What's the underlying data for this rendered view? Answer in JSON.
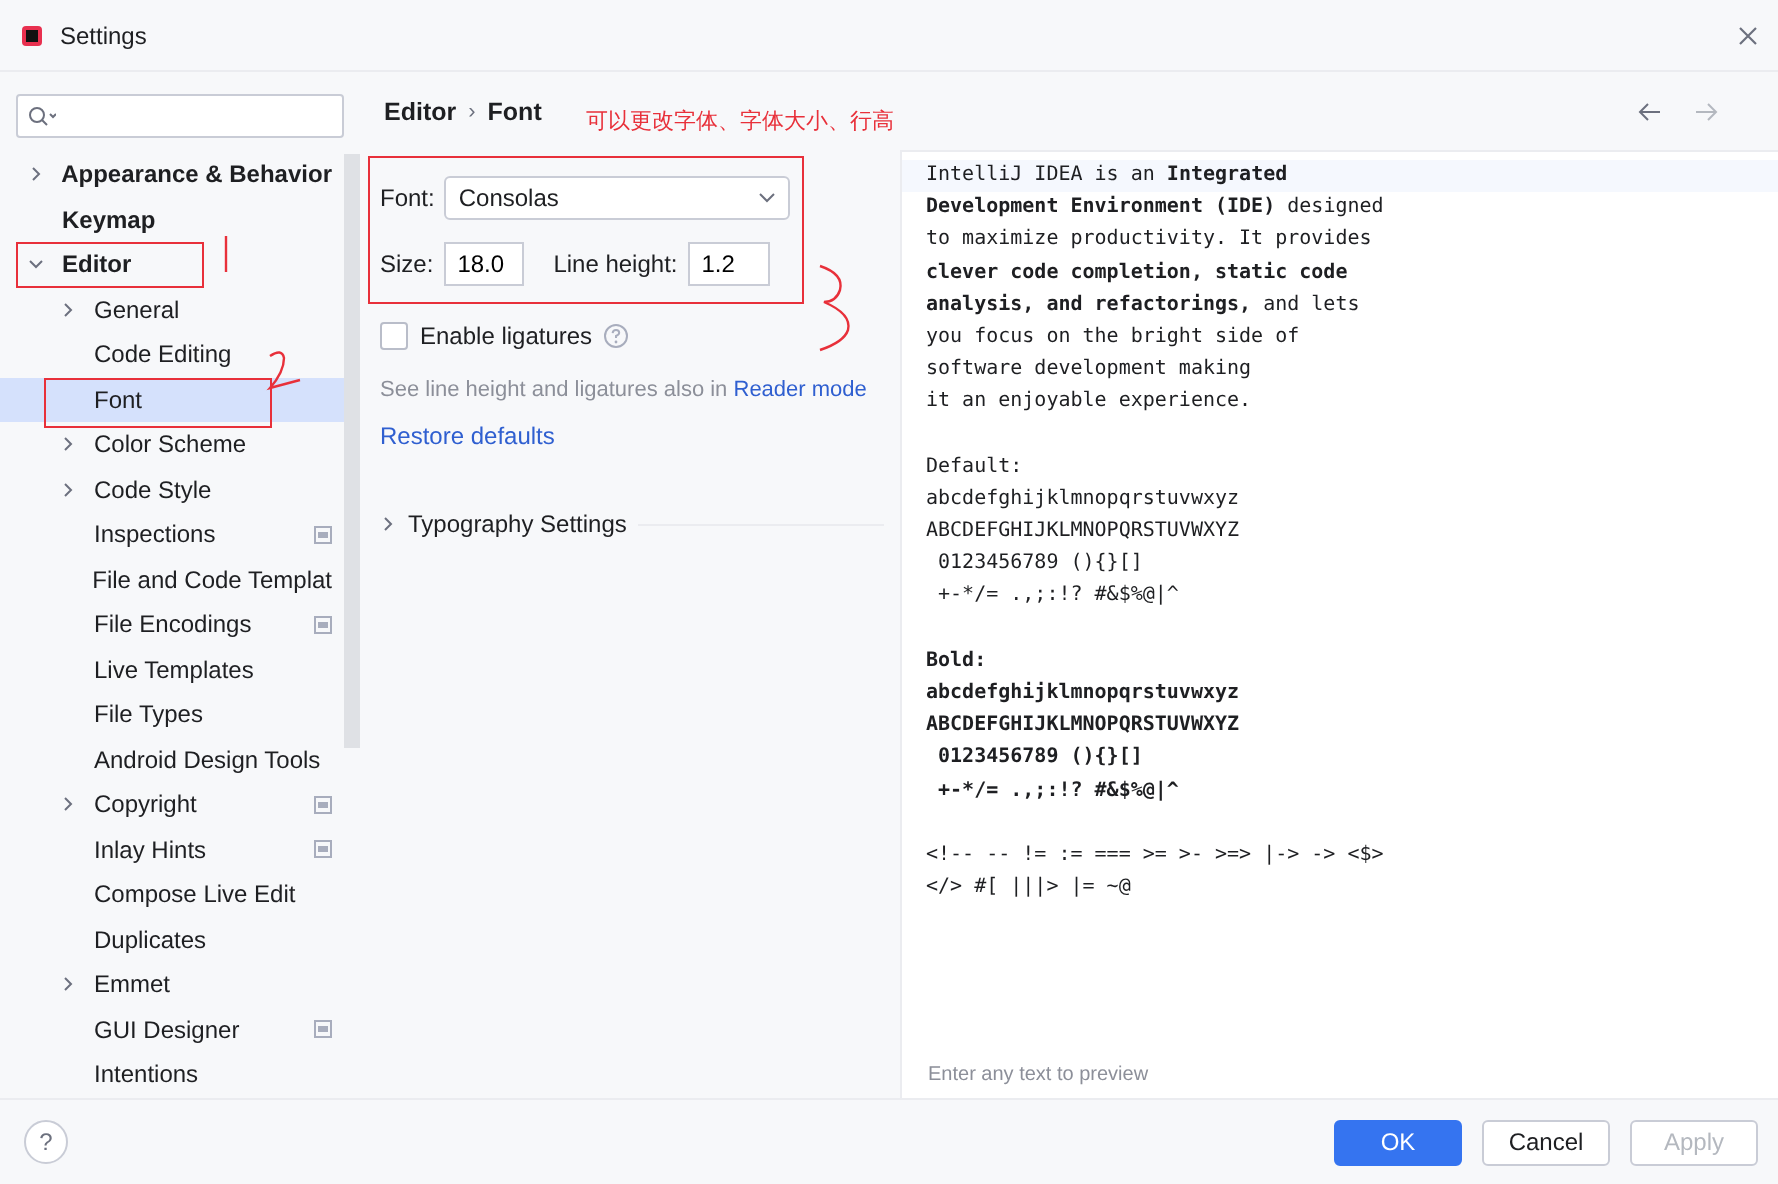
{
  "window": {
    "title": "Settings"
  },
  "sidebar": {
    "items": [
      {
        "label": "Appearance & Behavior",
        "expandable": true,
        "expanded": false,
        "selected": false,
        "scoped": false
      },
      {
        "label": "Keymap",
        "expandable": false,
        "selected": false,
        "scoped": false
      },
      {
        "label": "Editor",
        "expandable": true,
        "expanded": true,
        "selected": false,
        "scoped": false,
        "children": [
          {
            "label": "General",
            "expandable": true,
            "expanded": false,
            "selected": false,
            "scoped": false
          },
          {
            "label": "Code Editing",
            "expandable": false,
            "selected": false,
            "scoped": false
          },
          {
            "label": "Font",
            "expandable": false,
            "selected": true,
            "scoped": false
          },
          {
            "label": "Color Scheme",
            "expandable": true,
            "expanded": false,
            "selected": false,
            "scoped": false
          },
          {
            "label": "Code Style",
            "expandable": true,
            "expanded": false,
            "selected": false,
            "scoped": false
          },
          {
            "label": "Inspections",
            "expandable": false,
            "selected": false,
            "scoped": true
          },
          {
            "label": "File and Code Templat",
            "expandable": false,
            "selected": false,
            "scoped": false
          },
          {
            "label": "File Encodings",
            "expandable": false,
            "selected": false,
            "scoped": true
          },
          {
            "label": "Live Templates",
            "expandable": false,
            "selected": false,
            "scoped": false
          },
          {
            "label": "File Types",
            "expandable": false,
            "selected": false,
            "scoped": false
          },
          {
            "label": "Android Design Tools",
            "expandable": false,
            "selected": false,
            "scoped": false
          },
          {
            "label": "Copyright",
            "expandable": true,
            "expanded": false,
            "selected": false,
            "scoped": true
          },
          {
            "label": "Inlay Hints",
            "expandable": false,
            "selected": false,
            "scoped": true
          },
          {
            "label": "Compose Live Edit",
            "expandable": false,
            "selected": false,
            "scoped": false
          },
          {
            "label": "Duplicates",
            "expandable": false,
            "selected": false,
            "scoped": false
          },
          {
            "label": "Emmet",
            "expandable": true,
            "expanded": false,
            "selected": false,
            "scoped": false
          },
          {
            "label": "GUI Designer",
            "expandable": false,
            "selected": false,
            "scoped": true
          },
          {
            "label": "Intentions",
            "expandable": false,
            "selected": false,
            "scoped": false
          }
        ]
      }
    ]
  },
  "breadcrumb": [
    "Editor",
    "Font"
  ],
  "breadcrumb_separator": "›",
  "help": "?",
  "form": {
    "font_label": "Font:",
    "font_value": "Consolas",
    "size_label": "Size:",
    "size_value": "18.0",
    "line_height_label": "Line height:",
    "line_height_value": "1.2",
    "ligatures": {
      "label": "Enable ligatures",
      "checked": false
    },
    "note": "See line height and ligatures also in",
    "note_link": "Reader mode",
    "restore": "Restore defaults",
    "typography": {
      "label": "Typography Settings",
      "expanded": false
    }
  },
  "preview": {
    "sections": [
      {
        "bold": false,
        "lines": [
          "IntelliJ IDEA is an **Integrated**",
          "**Development Environment (IDE)** designed",
          "to maximize productivity. It provides",
          "**clever code completion, static code**",
          "**analysis, and refactorings,** and lets",
          "you focus on the bright side of",
          "software development making",
          "it an enjoyable experience."
        ]
      },
      {
        "bold": false,
        "lines": [
          "Default:",
          "abcdefghijklmnopqrstuvwxyz",
          "ABCDEFGHIJKLMNOPQRSTUVWXYZ",
          " 0123456789 (){}[]",
          " +-*/= .,;:!? #&$%@|^"
        ]
      },
      {
        "bold": true,
        "lines": [
          "Bold:",
          "abcdefghijklmnopqrstuvwxyz",
          "ABCDEFGHIJKLMNOPQRSTUVWXYZ",
          " 0123456789 (){}[]",
          " +-*/= .,;:!? #&$%@|^"
        ]
      },
      {
        "bold": false,
        "lines": [
          "<!-- -- != := === >= >- >=> |-> -> <$>",
          "</> #[ |||> |= ~@"
        ]
      }
    ],
    "placeholder": "Enter any text to preview"
  },
  "buttons": [
    {
      "label": "OK",
      "kind": "primary",
      "disabled": false
    },
    {
      "label": "Cancel",
      "kind": "normal",
      "disabled": false
    },
    {
      "label": "Apply",
      "kind": "normal",
      "disabled": true
    }
  ],
  "annotations": {
    "note": "可以更改字体、字体大小、行高"
  }
}
